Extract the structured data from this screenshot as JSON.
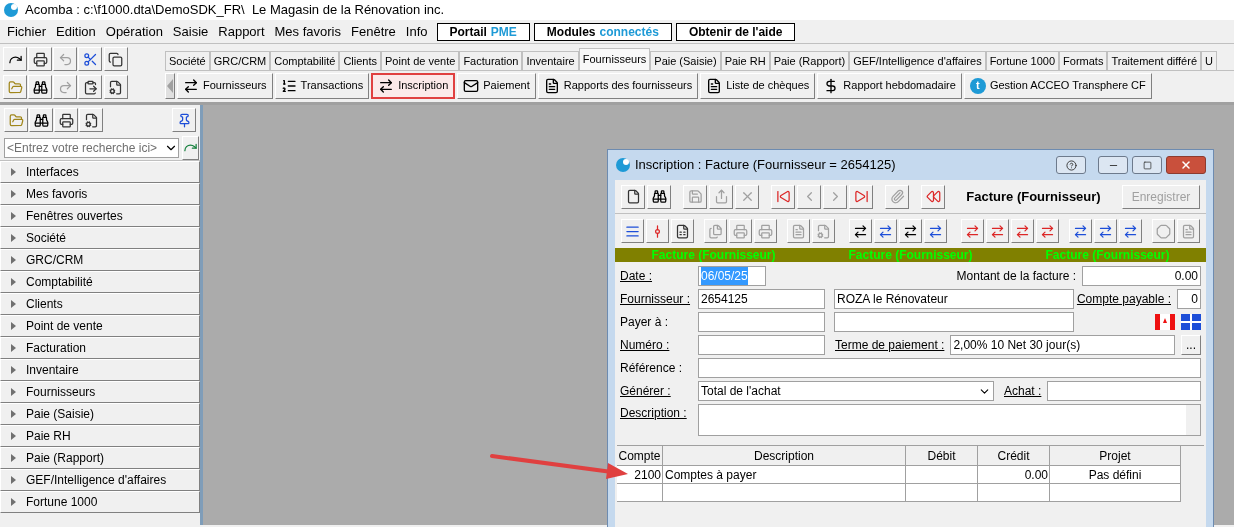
{
  "window": {
    "title": "Acomba : c:\\f1000.dta\\DemoSDK_FR\\  Le Magasin de la Rénovation inc."
  },
  "menu": [
    "Fichier",
    "Edition",
    "Opération",
    "Saisie",
    "Rapport",
    "Mes favoris",
    "Fenêtre",
    "Info"
  ],
  "menu_buttons": [
    {
      "label": "Portail",
      "accent": "PME"
    },
    {
      "label": "Modules",
      "accent": "connectés"
    },
    {
      "label": "Obtenir de l'aide"
    }
  ],
  "module_tabs": [
    {
      "label": "Société",
      "selected": false
    },
    {
      "label": "GRC/CRM",
      "selected": false
    },
    {
      "label": "Comptabilité",
      "selected": false
    },
    {
      "label": "Clients",
      "selected": false
    },
    {
      "label": "Point de vente",
      "selected": false
    },
    {
      "label": "Facturation",
      "selected": false
    },
    {
      "label": "Inventaire",
      "selected": false
    },
    {
      "label": "Fournisseurs",
      "selected": true
    },
    {
      "label": "Paie (Saisie)",
      "selected": false
    },
    {
      "label": "Paie RH",
      "selected": false
    },
    {
      "label": "Paie (Rapport)",
      "selected": false
    },
    {
      "label": "GEF/Intelligence d'affaires",
      "selected": false
    },
    {
      "label": "Fortune 1000",
      "selected": false
    },
    {
      "label": "Formats",
      "selected": false
    },
    {
      "label": "Traitement différé",
      "selected": false
    },
    {
      "label": "U",
      "selected": false
    }
  ],
  "module_buttons": [
    {
      "label": "Fournisseurs",
      "highlighted": false
    },
    {
      "label": "Transactions",
      "highlighted": false
    },
    {
      "label": "Inscription",
      "highlighted": true
    },
    {
      "label": "Paiement",
      "highlighted": false
    },
    {
      "label": "Rapports des fournisseurs",
      "highlighted": false
    },
    {
      "label": "Liste de chèques",
      "highlighted": false
    },
    {
      "label": "Rapport hebdomadaire",
      "highlighted": false
    },
    {
      "label": "Gestion ACCEO Transphere CF",
      "highlighted": false,
      "icon_letter": "t"
    }
  ],
  "sidebar": {
    "search": {
      "placeholder": "<Entrez votre recherche ici>"
    },
    "items": [
      {
        "label": "Interfaces",
        "expanded": false
      },
      {
        "label": "Mes favoris",
        "expanded": false
      },
      {
        "label": "Fenêtres ouvertes",
        "expanded": false
      },
      {
        "label": "Société",
        "expanded": false
      },
      {
        "label": "GRC/CRM",
        "expanded": false
      },
      {
        "label": "Comptabilité",
        "expanded": false
      },
      {
        "label": "Clients",
        "expanded": false
      },
      {
        "label": "Point de vente",
        "expanded": false
      },
      {
        "label": "Facturation",
        "expanded": false
      },
      {
        "label": "Inventaire",
        "expanded": false
      },
      {
        "label": "Fournisseurs",
        "expanded": false
      },
      {
        "label": "Paie (Saisie)",
        "expanded": false
      },
      {
        "label": "Paie RH",
        "expanded": false
      },
      {
        "label": "Paie (Rapport)",
        "expanded": false
      },
      {
        "label": "GEF/Intelligence d'affaires",
        "expanded": false
      },
      {
        "label": "Fortune 1000",
        "expanded": false
      }
    ]
  },
  "dialog": {
    "title": "Inscription : Facture (Fournisseur = 2654125)",
    "heading": "Facture (Fournisseur)",
    "save_button": {
      "label": "Enregistrer",
      "disabled": true
    },
    "banner": [
      "Facture (Fournisseur)",
      "Facture (Fournisseur)",
      "Facture (Fournisseur)"
    ],
    "form": {
      "date": {
        "label": "Date :",
        "underlined": true,
        "value": "06/05/25",
        "text_selected": true
      },
      "amount": {
        "label": "Montant de la facture :",
        "underlined": false,
        "value": "0.00"
      },
      "supplier": {
        "label": "Fournisseur :",
        "underlined": true,
        "value": "2654125",
        "name": "ROZA le Rénovateur"
      },
      "account": {
        "label": "Compte payable :",
        "underlined": true,
        "value": "0"
      },
      "pay_to": {
        "label": "Payer à :",
        "underlined": false
      },
      "number": {
        "label": "Numéro :",
        "underlined": true
      },
      "terms": {
        "label": "Terme de paiement :",
        "underlined": true,
        "value": "2,00% 10 Net 30 jour(s)",
        "button": "..."
      },
      "reference": {
        "label": "Référence :",
        "underlined": false
      },
      "generate": {
        "label": "Générer :",
        "underlined": true,
        "value": "Total de l'achat"
      },
      "purchase": {
        "label": "Achat :",
        "underlined": true
      },
      "description": {
        "label": "Description :",
        "underlined": true
      }
    },
    "table": {
      "columns": [
        "Compte",
        "Description",
        "Débit",
        "Crédit",
        "Projet"
      ],
      "rows": [
        {
          "account": "2100",
          "description": "Comptes à payer",
          "credit": "0.00",
          "project": "Pas défini"
        }
      ]
    }
  }
}
